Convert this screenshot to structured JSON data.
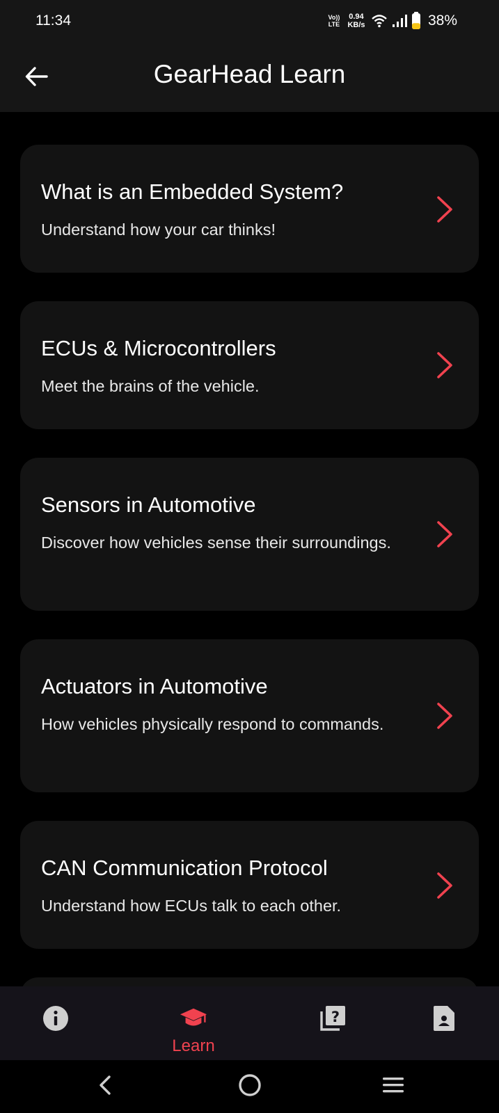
{
  "status_bar": {
    "time": "11:34",
    "volte_top": "Vo))",
    "volte_bottom": "LTE",
    "speed_value": "0.94",
    "speed_unit": "KB/s",
    "battery_percent": "38%",
    "battery_level": 0.38,
    "icons": [
      "wifi-icon",
      "signal-icon",
      "battery-icon"
    ]
  },
  "app_bar": {
    "title": "GearHead Learn",
    "back_icon": "arrow-left-icon"
  },
  "cards": [
    {
      "title": "What is an Embedded System?",
      "subtitle": "Understand how your car thinks!"
    },
    {
      "title": "ECUs & Microcontrollers",
      "subtitle": "Meet the brains of the vehicle."
    },
    {
      "title": "Sensors in Automotive",
      "subtitle": "Discover how vehicles sense their surroundings."
    },
    {
      "title": "Actuators in Automotive",
      "subtitle": "How vehicles physically respond to commands."
    },
    {
      "title": "CAN Communication Protocol",
      "subtitle": "Understand how ECUs talk to each other."
    }
  ],
  "bottom_nav": {
    "items": [
      {
        "icon": "info-icon",
        "label": "",
        "active": false
      },
      {
        "icon": "graduation-cap-icon",
        "label": "Learn",
        "active": true
      },
      {
        "icon": "quiz-icon",
        "label": "",
        "active": false
      },
      {
        "icon": "profile-document-icon",
        "label": "",
        "active": false
      }
    ]
  },
  "system_nav": {
    "icons": [
      "back-icon",
      "home-icon",
      "recents-icon"
    ]
  },
  "colors": {
    "accent": "#f0424f",
    "background": "#000000",
    "card": "#131313",
    "bar": "#161616",
    "nav": "#15131a",
    "battery_fill": "#f5c518"
  }
}
